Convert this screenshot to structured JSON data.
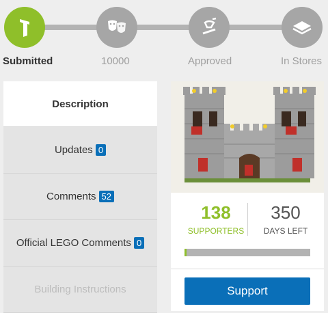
{
  "progress": {
    "stages": [
      {
        "label": "Submitted",
        "icon": "lego-brick-icon",
        "active": true
      },
      {
        "label": "10000",
        "icon": "theater-masks-icon",
        "active": false
      },
      {
        "label": "Approved",
        "icon": "approved-stamp-icon",
        "active": false
      },
      {
        "label": "In Stores",
        "icon": "box-icon",
        "active": false
      }
    ],
    "colors": {
      "active": "#8fbf2a",
      "inactive": "#a6a6a6"
    }
  },
  "tabs": [
    {
      "label": "Description",
      "badge": null,
      "state": "selected"
    },
    {
      "label": "Updates",
      "badge": "0",
      "state": "normal"
    },
    {
      "label": "Comments",
      "badge": "52",
      "state": "normal"
    },
    {
      "label": "Official LEGO Comments",
      "badge": "0",
      "state": "normal"
    },
    {
      "label": "Building Instructions",
      "badge": null,
      "state": "disabled"
    }
  ],
  "project": {
    "image_alt": "LEGO castle model",
    "supporters": {
      "value": "138",
      "label": "SUPPORTERS"
    },
    "days_left": {
      "value": "350",
      "label": "DAYS LEFT"
    },
    "support_progress": 0.0138,
    "support_button": "Support"
  },
  "colors": {
    "accent": "#8fbf2a",
    "button": "#0a6fb8",
    "badge": "#0a6fb8"
  }
}
